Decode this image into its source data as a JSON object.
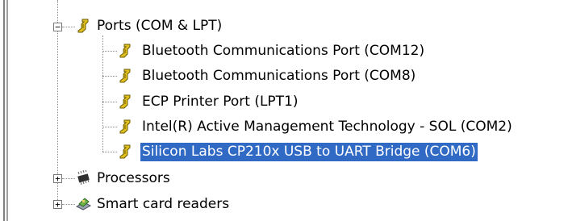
{
  "tree": {
    "ports": {
      "label": "Ports (COM & LPT)",
      "icon": "port-icon",
      "expander": "−",
      "children": [
        {
          "label": "Bluetooth Communications Port (COM12)",
          "icon": "port-icon"
        },
        {
          "label": "Bluetooth Communications Port (COM8)",
          "icon": "port-icon"
        },
        {
          "label": "ECP Printer Port (LPT1)",
          "icon": "port-icon"
        },
        {
          "label": "Intel(R) Active Management Technology - SOL (COM2)",
          "icon": "port-icon"
        },
        {
          "label": "Silicon Labs CP210x USB to UART Bridge (COM6)",
          "icon": "port-icon",
          "selected": true
        }
      ]
    },
    "processors": {
      "label": "Processors",
      "icon": "processor-chip-icon",
      "expander": "+"
    },
    "smart_card_readers": {
      "label": "Smart card readers",
      "icon": "smart-card-reader-icon",
      "expander": "+"
    }
  },
  "colors": {
    "selection": "#316ac5",
    "selection_text": "#ffffff"
  }
}
